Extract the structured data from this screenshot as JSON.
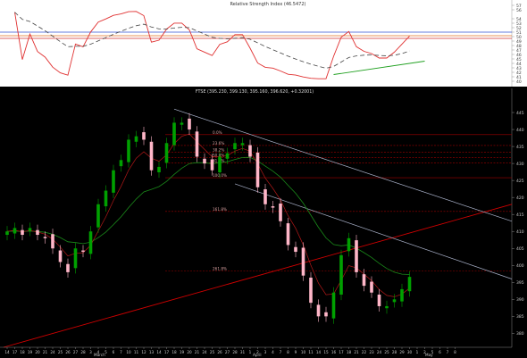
{
  "rsi_panel": {
    "title": "Relative Strength Index (46.5472)",
    "y_ticks": [
      "57",
      "56",
      "54",
      "53",
      "52",
      "51",
      "50",
      "49",
      "48",
      "47",
      "46",
      "45",
      "44",
      "43",
      "42",
      "41",
      "40"
    ]
  },
  "price_panel": {
    "title": "FTSE (395.230, 399.130, 395.160, 396.620, +0.32001)",
    "y_ticks": [
      "445",
      "440",
      "435",
      "430",
      "425",
      "420",
      "415",
      "410",
      "405",
      "400",
      "395",
      "390",
      "385",
      "380"
    ]
  },
  "fib_labels": [
    {
      "label": "0.0%",
      "value": 438.5
    },
    {
      "label": "23.6%",
      "value": 435.3
    },
    {
      "label": "38.2%",
      "value": 433.3
    },
    {
      "label": "50.0%",
      "value": 431.7
    },
    {
      "label": "61.8%",
      "value": 430.2
    },
    {
      "label": "100.0%",
      "value": 425.8
    },
    {
      "label": "161.8%",
      "value": 415.9
    },
    {
      "label": "261.8%",
      "value": 398.4
    }
  ],
  "x_axis": {
    "ticks": [
      "14",
      "17",
      "18",
      "19",
      "20",
      "21",
      "24",
      "25",
      "26",
      "27",
      "28",
      "3",
      "4",
      "5",
      "6",
      "7",
      "10",
      "11",
      "12",
      "13",
      "14",
      "17",
      "18",
      "19",
      "20",
      "21",
      "24",
      "25",
      "26",
      "27",
      "28",
      "31",
      "1",
      "2",
      "3",
      "4",
      "7",
      "8",
      "9",
      "10",
      "11",
      "14",
      "15",
      "16",
      "17",
      "18",
      "21",
      "22",
      "23",
      "24",
      "25",
      "28",
      "29",
      "30",
      "1",
      "2",
      "5",
      "6",
      "7",
      "8"
    ],
    "months": [
      "March",
      "April",
      "May"
    ]
  },
  "chart_data": {
    "type": "candlestick",
    "title": "FTSE (395.230, 399.130, 395.160, 396.620, +0.32001)",
    "ylim": [
      378,
      450
    ],
    "indicator": {
      "name": "Relative Strength Index (46.5472)",
      "ylim": [
        40,
        57
      ]
    },
    "x": [
      "14",
      "17",
      "18",
      "19",
      "20",
      "21",
      "24",
      "25",
      "26",
      "27",
      "28",
      "3",
      "4",
      "5",
      "6",
      "7",
      "10",
      "11",
      "12",
      "13",
      "14",
      "17",
      "18",
      "19",
      "20",
      "21",
      "24",
      "25",
      "26",
      "27",
      "28",
      "31",
      "1",
      "2",
      "3",
      "4",
      "7",
      "8",
      "9",
      "10",
      "11",
      "14",
      "15",
      "16",
      "17",
      "18",
      "21",
      "22",
      "23",
      "24",
      "25",
      "28",
      "29",
      "30"
    ],
    "close": [
      410,
      411,
      409,
      411,
      409,
      408,
      405,
      401,
      398,
      405,
      404,
      410,
      418,
      422,
      428,
      431,
      437,
      438,
      437,
      428,
      429,
      436,
      442,
      442,
      440,
      432,
      430,
      428,
      432,
      433,
      436,
      436,
      432,
      423,
      418,
      417,
      413,
      406,
      404,
      397,
      389,
      385,
      385,
      392,
      403,
      408,
      398,
      394,
      392,
      388,
      388,
      390,
      393,
      396.62
    ]
  },
  "colors": {
    "background": "#000000",
    "rsi_background": "#ffffff",
    "up_candle": "#00a000",
    "down_candle": "#ffb6c8",
    "fib_line": "#a00000",
    "trend_red": "#d00000",
    "channel": "#a8b0c8"
  }
}
